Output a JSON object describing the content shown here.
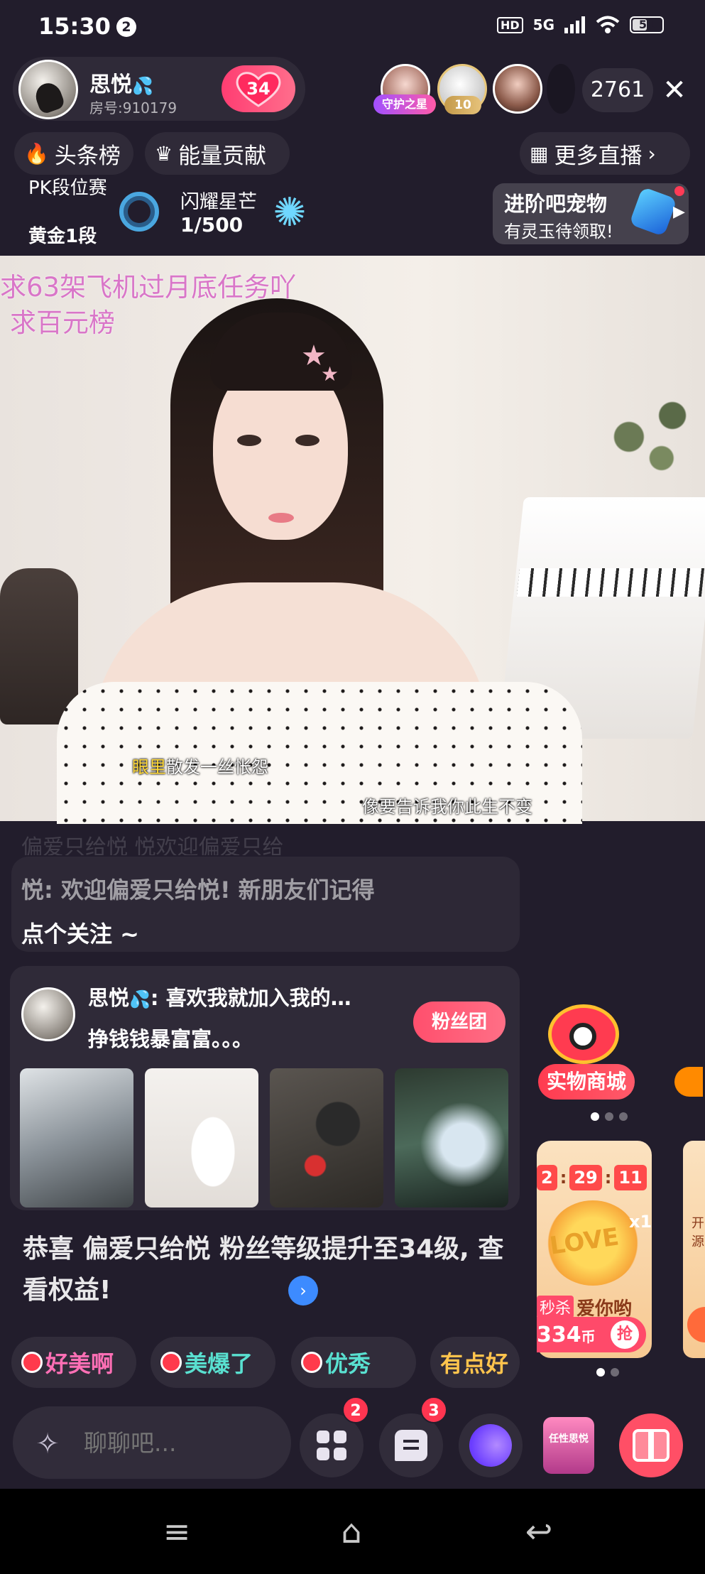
{
  "status_bar": {
    "time": "15:30",
    "notification_count": "2",
    "hd": "HD",
    "network": "5G",
    "battery": "51",
    "battery_level": 0.51
  },
  "host": {
    "name": "思悦",
    "room_label": "房号:910179",
    "follow_count": "34"
  },
  "viewers": {
    "guard_tag": "守护之星",
    "level_tag": "10",
    "count": "2761"
  },
  "nav": {
    "hot_rank": "头条榜",
    "energy": "能量贡献",
    "more_live": "更多直播"
  },
  "pk": {
    "title": "PK段位赛",
    "rank": "黄金1段"
  },
  "star": {
    "title": "闪耀星芒",
    "progress": "1/500"
  },
  "pet": {
    "title": "进阶吧宠物",
    "subtitle": "有灵玉待领取!"
  },
  "video": {
    "overlay_line1": "求63架飞机过月底任务吖",
    "overlay_line2": "求百元榜",
    "lyric1_highlight": "眼里",
    "lyric1_rest": "散发一丝怅怨",
    "lyric2": "像要告诉我你此生不变"
  },
  "chat": {
    "faded_line": "偏爱只给悦 悦欢迎偏爱只给",
    "welcome_line1": "悦: 欢迎偏爱只给悦! 新朋友们记得",
    "welcome_line2": "点个关注 ~"
  },
  "fan_card": {
    "name": "思悦",
    "message_head": ": 喜欢我就加入我的…",
    "message_line2": "挣钱钱暴富富。。。",
    "button": "粉丝团",
    "upgrade_text": "恭喜 偏爱只给悦 粉丝等级提升至34级, 查看权益!"
  },
  "quick_replies": [
    "好美啊",
    "美爆了",
    "优秀",
    "有点好"
  ],
  "shop": {
    "label": "实物商城",
    "timer": [
      "2",
      "29",
      "11"
    ],
    "promo_art": "LOVE",
    "promo_multiplier": "x1",
    "promo_tag": "秒杀",
    "promo_name": "爱你哟",
    "price": "334",
    "price_unit": "币",
    "grab": "抢",
    "next_card_text": "开源"
  },
  "bottom": {
    "chat_placeholder": "聊聊吧...",
    "grid_badge": "2",
    "chat_badge": "3",
    "badge_label": "任性思悦"
  },
  "icons": [
    "water-drop-icon",
    "heart-icon",
    "close-icon",
    "flame-icon",
    "crown-icon",
    "grid-icon",
    "chevron-right-icon",
    "swirl-icon",
    "star-icon",
    "gem-icon",
    "message-icon",
    "mic-icon",
    "gift-icon",
    "menu-icon",
    "home-icon",
    "back-icon"
  ],
  "colors": {
    "background": "#221d2c",
    "accent_pink": "#ff4f6d",
    "overlay_text": "#d976c8",
    "lyric_highlight": "#ffd93b"
  }
}
